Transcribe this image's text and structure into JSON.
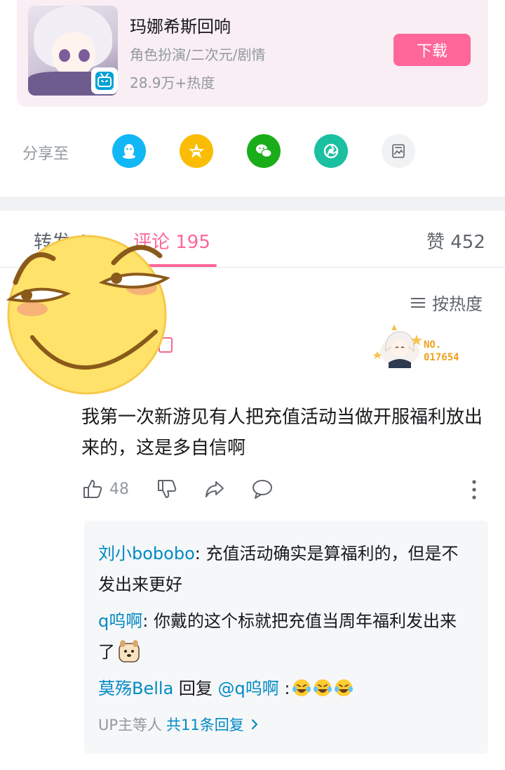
{
  "game_card": {
    "title": "玛娜希斯回响",
    "tags": "角色扮演/二次元/剧情",
    "heat": "28.9万+热度",
    "download_label": "下载"
  },
  "share": {
    "label": "分享至",
    "targets": [
      {
        "icon": "qq-icon",
        "color": "#12b7f5"
      },
      {
        "icon": "qzone-icon",
        "color": "#fbbc05"
      },
      {
        "icon": "wechat-icon",
        "color": "#1aad19"
      },
      {
        "icon": "moments-icon",
        "color": "#1ac0a0"
      },
      {
        "icon": "image-share-icon",
        "color": "#e7e7e7"
      }
    ]
  },
  "tabs": {
    "repost": "转发 4",
    "comments": "评论 195",
    "likes": "赞 452"
  },
  "sort_label": "按热度",
  "comment": {
    "fan_badge_no": "NO.\n017654",
    "text": "我第一次新游见有人把充值活动当做开服福利放出来的，这是多自信啊",
    "like_count": "48"
  },
  "replies": [
    {
      "user": "刘小bobobo",
      "text": ": 充值活动确实是算福利的，但是不发出来更好"
    },
    {
      "user": "q呜啊",
      "text": ": 你戴的这个标就把充值当周年福利发出来了"
    },
    {
      "user": "莫殇Bella",
      "prefix": " 回复 ",
      "mention": "@q呜啊",
      "text": " :"
    }
  ],
  "more_replies": {
    "prefix": "UP主等人 ",
    "link": "共11条回复"
  },
  "colors": {
    "accent": "#ff6699",
    "link": "#008ac5"
  }
}
